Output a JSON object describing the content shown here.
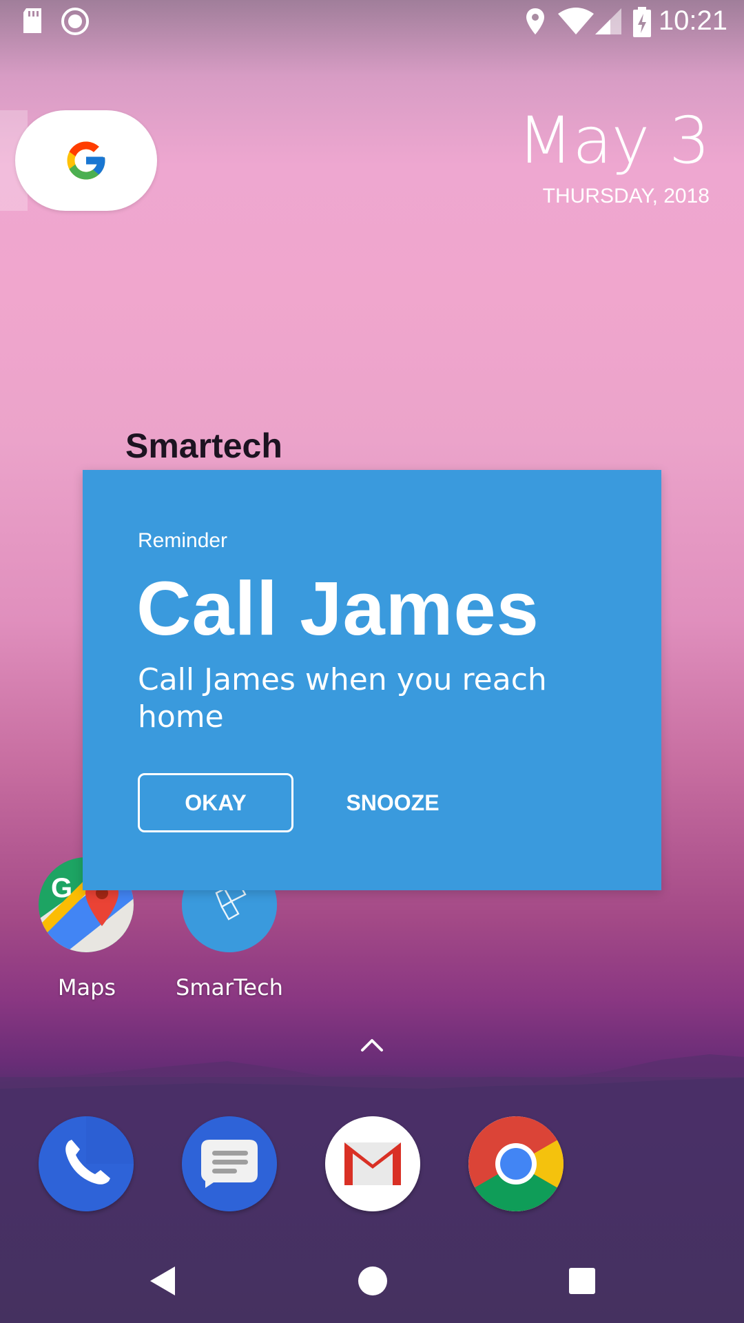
{
  "status_bar": {
    "time": "10:21",
    "icons": [
      "sd-card-icon",
      "record-icon",
      "location-icon",
      "wifi-icon",
      "signal-icon",
      "battery-charging-icon"
    ]
  },
  "date_widget": {
    "date": "May 3",
    "day": "THURSDAY, 2018"
  },
  "widget": {
    "label": "Smartech"
  },
  "reminder": {
    "kicker": "Reminder",
    "title": "Call James",
    "body": "Call James when you reach home",
    "okay_label": "OKAY",
    "snooze_label": "SNOOZE",
    "background_color": "#3a9add"
  },
  "home_apps": [
    {
      "label": "Maps",
      "icon": "maps-icon"
    },
    {
      "label": "SmarTech",
      "icon": "smartech-icon"
    }
  ],
  "dock": [
    {
      "icon": "phone-icon"
    },
    {
      "icon": "messages-icon"
    },
    {
      "icon": "gmail-icon"
    },
    {
      "icon": "chrome-icon"
    }
  ],
  "nav": [
    "back-icon",
    "home-icon",
    "recents-icon"
  ]
}
